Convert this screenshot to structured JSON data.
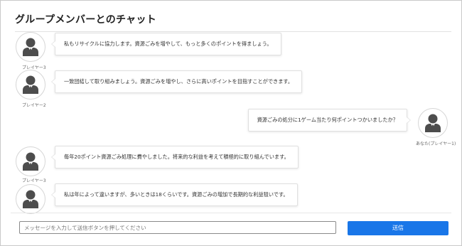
{
  "header": {
    "title": "グループメンバーとのチャット"
  },
  "messages": [
    {
      "side": "left",
      "author": "プレイヤー3",
      "text": "私もリサイクルに協力します。資源ごみを増やして、もっと多くのポイントを得ましょう。"
    },
    {
      "side": "left",
      "author": "プレイヤー2",
      "text": "一致団結して取り組みましょう。資源ごみを増やし、さらに高いポイントを目指すことができます。"
    },
    {
      "side": "right",
      "author": "あなた(プレイヤー1)",
      "text": "資源ごみの処分に1ゲーム当たり何ポイントつかいましたか？"
    },
    {
      "side": "left",
      "author": "プレイヤー3",
      "text": "毎年20ポイント資源ごみ処理に費やしました。将来的な利益を考えて積極的に取り組んでいます。"
    },
    {
      "side": "left",
      "author": "",
      "text": "私は年によって違いますが、多いときは18くらいです。資源ごみの増加で長期的な利益狙いです。"
    }
  ],
  "composer": {
    "placeholder": "メッセージを入力して送信ボタンを押してください",
    "value": "",
    "send_label": "送信"
  },
  "colors": {
    "accent": "#1976e8",
    "avatar_figure": "#4d4d4d",
    "avatar_shirt": "#ffffff"
  },
  "icons": {
    "avatar": "person-avatar-icon"
  }
}
